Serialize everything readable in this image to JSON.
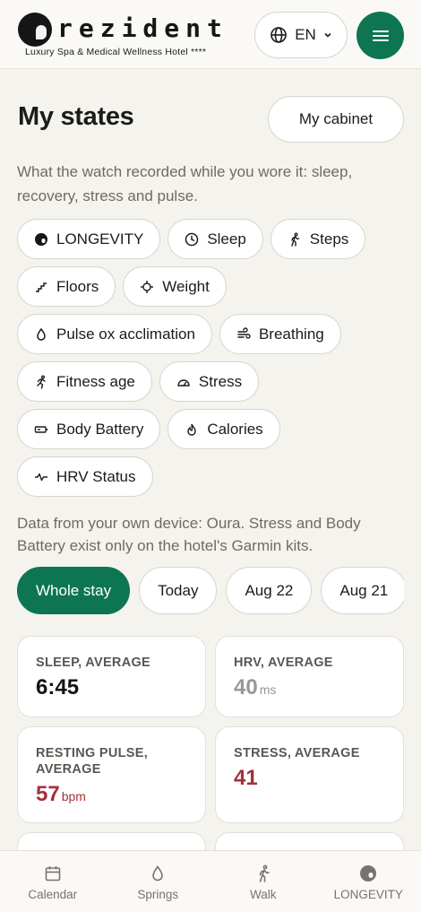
{
  "header": {
    "logo_word": "rezident",
    "logo_tagline": "Luxury Spa & Medical Wellness Hotel ****",
    "language": "EN"
  },
  "page": {
    "title": "My states",
    "cabinet_label": "My cabinet",
    "intro": "What the watch recorded while you wore it: sleep, recovery, stress and pulse.",
    "note": "Data from your own device: Oura. Stress and Body Battery exist only on the hotel's Garmin kits."
  },
  "chips": [
    {
      "label": "LONGEVITY",
      "icon": "longevity-icon"
    },
    {
      "label": "Sleep",
      "icon": "clock-icon"
    },
    {
      "label": "Steps",
      "icon": "walking-icon"
    },
    {
      "label": "Floors",
      "icon": "stairs-icon"
    },
    {
      "label": "Weight",
      "icon": "crosshair-icon"
    },
    {
      "label": "Pulse ox acclimation",
      "icon": "drop-icon"
    },
    {
      "label": "Breathing",
      "icon": "wind-icon"
    },
    {
      "label": "Fitness age",
      "icon": "running-icon"
    },
    {
      "label": "Stress",
      "icon": "gauge-icon"
    },
    {
      "label": "Body Battery",
      "icon": "battery-icon"
    },
    {
      "label": "Calories",
      "icon": "flame-icon"
    },
    {
      "label": "HRV Status",
      "icon": "pulse-icon"
    }
  ],
  "periods": [
    {
      "label": "Whole stay",
      "active": true
    },
    {
      "label": "Today",
      "active": false
    },
    {
      "label": "Aug 22",
      "active": false
    },
    {
      "label": "Aug 21",
      "active": false
    }
  ],
  "stats": {
    "sleep": {
      "label": "SLEEP, AVERAGE",
      "value": "6:45",
      "unit": ""
    },
    "hrv": {
      "label": "HRV, AVERAGE",
      "value": "40",
      "unit": "ms"
    },
    "pulse": {
      "label": "RESTING PULSE, AVERAGE",
      "value": "57",
      "unit": "bpm"
    },
    "stress": {
      "label": "STRESS, AVERAGE",
      "value": "41",
      "unit": ""
    }
  },
  "bottom_nav": [
    {
      "label": "Calendar",
      "icon": "calendar-icon"
    },
    {
      "label": "Springs",
      "icon": "drop-icon"
    },
    {
      "label": "Walk",
      "icon": "walking-icon"
    },
    {
      "label": "LONGEVITY",
      "icon": "longevity-icon"
    }
  ],
  "colors": {
    "accent": "#0e7552",
    "warning_value": "#a3313a",
    "background": "#f5f3ee"
  }
}
